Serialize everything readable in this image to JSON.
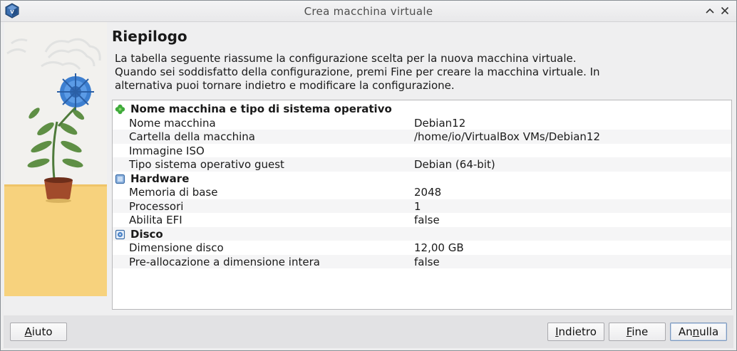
{
  "window": {
    "title": "Crea macchina virtuale"
  },
  "page": {
    "title": "Riepilogo",
    "description_lines": [
      "La tabella seguente riassume la configurazione scelta per la nuova macchina virtuale.",
      "Quando sei soddisfatto della configurazione, premi Fine per creare la macchina virtuale. In",
      "alternativa puoi tornare indietro e modificare la configurazione."
    ]
  },
  "summary": {
    "sections": [
      {
        "title": "Nome macchina e tipo di sistema operativo",
        "icon": "clover-icon",
        "rows": [
          {
            "key": "Nome macchina",
            "value": "Debian12"
          },
          {
            "key": "Cartella della macchina",
            "value": "/home/io/VirtualBox VMs/Debian12"
          },
          {
            "key": "Immagine ISO",
            "value": ""
          },
          {
            "key": "Tipo sistema operativo guest",
            "value": "Debian (64-bit)"
          }
        ]
      },
      {
        "title": "Hardware",
        "icon": "chip-icon",
        "rows": [
          {
            "key": "Memoria di base",
            "value": "2048"
          },
          {
            "key": "Processori",
            "value": "1"
          },
          {
            "key": "Abilita EFI",
            "value": "false"
          }
        ]
      },
      {
        "title": "Disco",
        "icon": "hard-disk-icon",
        "rows": [
          {
            "key": "Dimensione disco",
            "value": "12,00 GB"
          },
          {
            "key": "Pre-allocazione a dimensione intera",
            "value": "false"
          }
        ]
      }
    ]
  },
  "buttons": {
    "help": {
      "pre": "",
      "mnemonic": "A",
      "post": "iuto"
    },
    "back": {
      "pre": "",
      "mnemonic": "I",
      "post": "ndietro"
    },
    "finish": {
      "pre": "",
      "mnemonic": "F",
      "post": "ine"
    },
    "cancel": {
      "pre": "An",
      "mnemonic": "n",
      "post": "ulla"
    }
  },
  "colors": {
    "accent": "#7c98bd",
    "side_floor": "#f7d27d",
    "flower": "#3d7fd0"
  }
}
